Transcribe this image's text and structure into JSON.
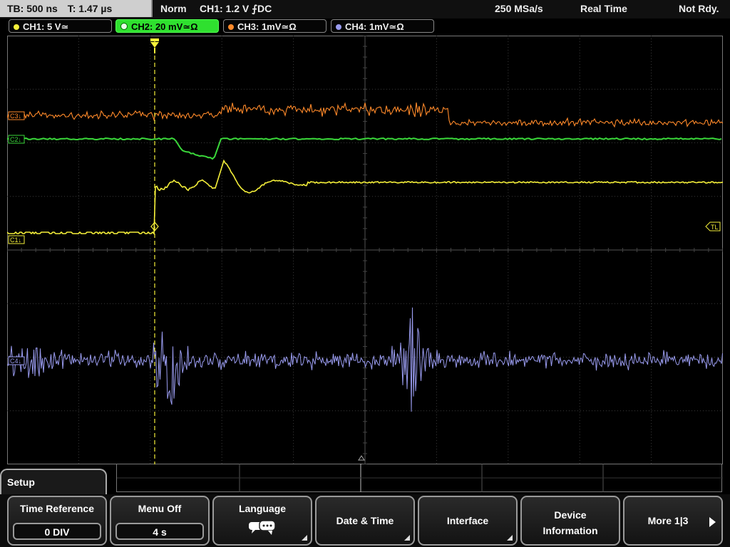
{
  "status": {
    "timebase": "TB: 500 ns",
    "trigger_time": "T: 1.47 µs",
    "mode": "Norm",
    "trigger": "CH1: 1.2 V ⨍DC",
    "sample_rate": "250 MSa/s",
    "acquisition": "Real Time",
    "state": "Not Rdy."
  },
  "channels": [
    {
      "label": "CH1: 5 V≃",
      "color": "#f5f03a",
      "active": false
    },
    {
      "label": "CH2: 20 mV≃Ω",
      "color": "#3ad83a",
      "active": true
    },
    {
      "label": "CH3: 1mV≃Ω",
      "color": "#ff8a2a",
      "active": false
    },
    {
      "label": "CH4: 1mV≃Ω",
      "color": "#9a9cf0",
      "active": false
    }
  ],
  "markers": {
    "c1": "C1↓",
    "c2": "C2↓",
    "c3": "C3↓",
    "c4": "C4↓",
    "tl": "TL",
    "trigger_icon": "trigger-position-marker"
  },
  "menu": {
    "title": "Setup",
    "keys": [
      {
        "label": "Time Reference",
        "value": "0 DIV"
      },
      {
        "label": "Menu Off",
        "value": "4 s"
      },
      {
        "label": "Language",
        "icon": "speech-bubbles-icon"
      },
      {
        "label": "Date & Time"
      },
      {
        "label": "Interface"
      },
      {
        "label": "Device",
        "label2": "Information"
      },
      {
        "label": "More 1|3"
      }
    ]
  },
  "colors": {
    "ch1": "#f5f03a",
    "ch2": "#3ad83a",
    "ch3": "#ff8a2a",
    "ch4": "#9a9cf0",
    "grid": "#3a3a3a"
  }
}
